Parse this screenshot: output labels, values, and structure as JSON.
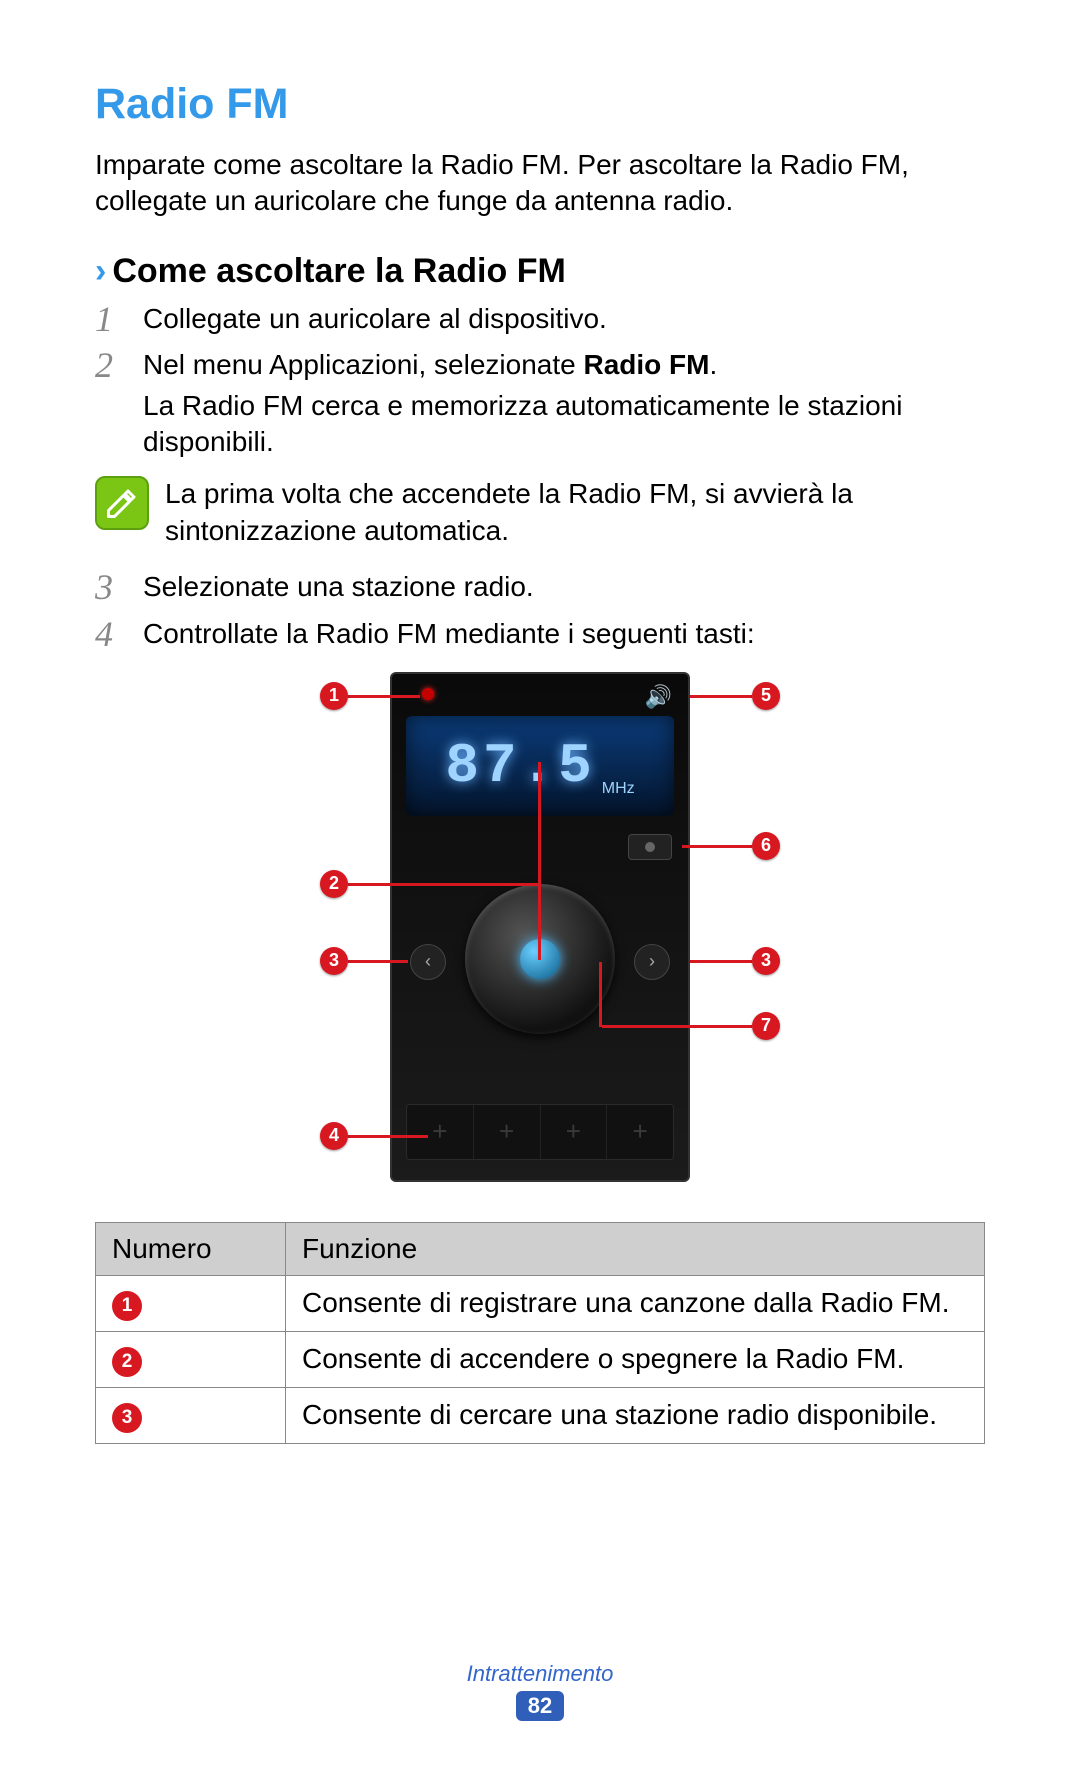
{
  "title": "Radio FM",
  "intro": "Imparate come ascoltare la Radio FM. Per ascoltare la Radio FM, collegate un auricolare che funge da antenna radio.",
  "section": {
    "chevron": "›",
    "title": "Come ascoltare la Radio FM"
  },
  "steps": {
    "s1": {
      "num": "1",
      "text": "Collegate un auricolare al dispositivo."
    },
    "s2": {
      "num": "2",
      "prefix": "Nel menu Applicazioni, selezionate ",
      "bold": "Radio FM",
      "suffix": ".",
      "sub": "La Radio FM cerca e memorizza automaticamente le stazioni disponibili."
    },
    "s3": {
      "num": "3",
      "text": "Selezionate una stazione radio."
    },
    "s4": {
      "num": "4",
      "text": "Controllate la Radio FM mediante i seguenti tasti:"
    }
  },
  "note": "La prima volta che accendete la Radio FM, si avvierà la sintonizzazione automatica.",
  "radio": {
    "frequency": "87.5",
    "unit": "MHz",
    "callouts": {
      "c1": "1",
      "c2": "2",
      "c3l": "3",
      "c3r": "3",
      "c4": "4",
      "c5": "5",
      "c6": "6",
      "c7": "7"
    }
  },
  "table": {
    "h1": "Numero",
    "h2": "Funzione",
    "rows": {
      "r1": {
        "n": "1",
        "f": "Consente di registrare una canzone dalla Radio FM."
      },
      "r2": {
        "n": "2",
        "f": "Consente di accendere o spegnere la Radio FM."
      },
      "r3": {
        "n": "3",
        "f": "Consente di cercare una stazione radio disponibile."
      }
    }
  },
  "footer": {
    "section": "Intrattenimento",
    "page": "82"
  }
}
